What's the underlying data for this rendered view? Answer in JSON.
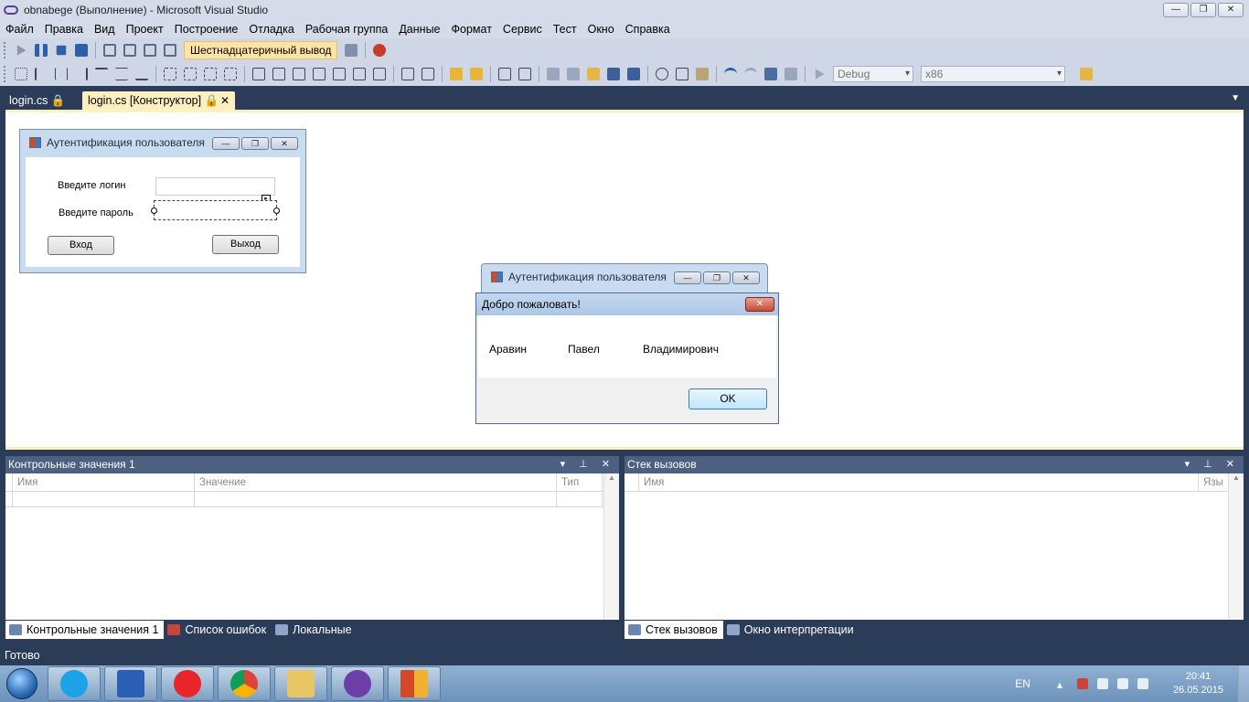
{
  "window": {
    "title": "obnabege (Выполнение) - Microsoft Visual Studio",
    "min": "—",
    "max": "❐",
    "close": "✕"
  },
  "menu": [
    "Файл",
    "Правка",
    "Вид",
    "Проект",
    "Построение",
    "Отладка",
    "Рабочая группа",
    "Данные",
    "Формат",
    "Сервис",
    "Тест",
    "Окно",
    "Справка"
  ],
  "toolbar": {
    "hex_label": "Шестнадцатеричный вывод",
    "config": "Debug",
    "platform": "x86"
  },
  "tabs": [
    {
      "label": "login.cs 🔒"
    },
    {
      "label": "login.cs [Конструктор] 🔒",
      "close": "✕"
    }
  ],
  "designer": {
    "form_title": "Аутентификация пользователя",
    "login_label": "Введите логин",
    "password_label": "Введите пароль",
    "enter_button": "Вход",
    "exit_button": "Выход",
    "smart_tag": "▸"
  },
  "runtime_form": {
    "title": "Аутентификация пользователя"
  },
  "messagebox": {
    "title": "Добро пожаловать!",
    "close": "✕",
    "words": [
      "Аравин",
      "Павел",
      "Владимирович"
    ],
    "ok": "OK"
  },
  "watch_panel": {
    "title": "Контрольные значения 1",
    "controls": "▾ ⊥ ✕",
    "columns": [
      "Имя",
      "Значение",
      "Тип"
    ],
    "tabs": [
      "Контрольные значения 1",
      "Список ошибок",
      "Локальные"
    ]
  },
  "callstack_panel": {
    "title": "Стек вызовов",
    "controls": "▾ ⊥ ✕",
    "columns": [
      "Имя",
      "Язы"
    ],
    "tabs": [
      "Стек вызовов",
      "Окно интерпретации"
    ]
  },
  "status": "Готово",
  "tray": {
    "lang": "EN",
    "time": "20:41",
    "date": "26.05.2015"
  },
  "colors": {
    "chrome": "#2b3c59",
    "tab_active": "#fdefc0",
    "hex_button": "#fde4a4"
  }
}
